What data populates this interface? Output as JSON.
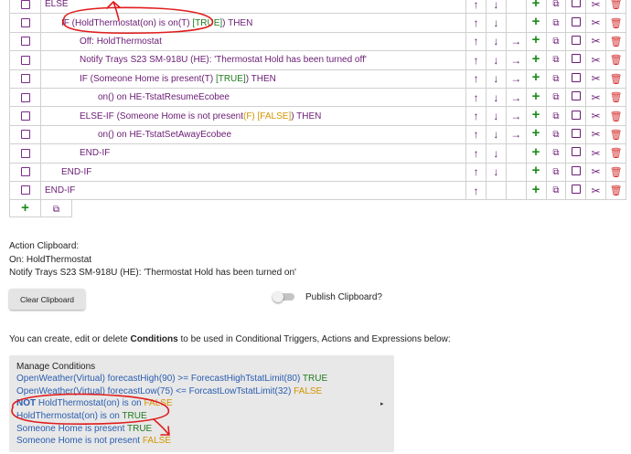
{
  "actions": {
    "rows": [
      {
        "indent": 0,
        "parts": [
          [
            "ELSE",
            "t"
          ]
        ],
        "arrows": [
          "up",
          "down"
        ]
      },
      {
        "indent": 1,
        "parts": [
          [
            "IF (HoldThermostat(on) is on(T) ",
            "t"
          ],
          [
            "[TRUE]",
            "ok"
          ],
          [
            ") THEN",
            "t"
          ]
        ],
        "arrows": [
          "up",
          "down"
        ]
      },
      {
        "indent": 2,
        "parts": [
          [
            "Off: HoldThermostat",
            "t"
          ]
        ],
        "arrows": [
          "up",
          "down",
          "right"
        ]
      },
      {
        "indent": 2,
        "parts": [
          [
            "Notify Trays S23 SM-918U (HE): 'Thermostat Hold has been turned off'",
            "t"
          ]
        ],
        "arrows": [
          "up",
          "down",
          "right"
        ]
      },
      {
        "indent": 2,
        "parts": [
          [
            "IF (Someone Home is present(T) ",
            "t"
          ],
          [
            "[TRUE]",
            "ok"
          ],
          [
            ") THEN",
            "t"
          ]
        ],
        "arrows": [
          "up",
          "down",
          "right"
        ]
      },
      {
        "indent": 3,
        "parts": [
          [
            "on() on HE-TstatResumeEcobee",
            "t"
          ]
        ],
        "arrows": [
          "up",
          "down",
          "right"
        ]
      },
      {
        "indent": 2,
        "parts": [
          [
            "ELSE-IF (Someone Home is not present",
            "t"
          ],
          [
            "(F) [FALSE]",
            "bad"
          ],
          [
            ") THEN",
            "t"
          ]
        ],
        "arrows": [
          "up",
          "down",
          "right"
        ]
      },
      {
        "indent": 3,
        "parts": [
          [
            "on() on HE-TstatSetAwayEcobee",
            "t"
          ]
        ],
        "arrows": [
          "up",
          "down",
          "right"
        ]
      },
      {
        "indent": 2,
        "parts": [
          [
            "END-IF",
            "t"
          ]
        ],
        "arrows": [
          "up",
          "down"
        ]
      },
      {
        "indent": 1,
        "parts": [
          [
            "END-IF",
            "t"
          ]
        ],
        "arrows": [
          "up",
          "down"
        ]
      },
      {
        "indent": 0,
        "parts": [
          [
            "END-IF",
            "t"
          ]
        ],
        "arrows": [
          "up"
        ]
      }
    ]
  },
  "clipboard": {
    "title": "Action Clipboard",
    "colon": ":",
    "line1": "On: HoldThermostat",
    "line2": "Notify Trays S23 SM-918U (HE): 'Thermostat Hold has been turned on'",
    "clear_label": "Clear Clipboard",
    "publish_label": "Publish Clipboard?",
    "publish_enabled": false
  },
  "conditions": {
    "intro_prefix": "You can create, edit or delete ",
    "intro_bold": "Conditions",
    "intro_suffix": " to be used in Conditional Triggers, Actions and Expressions below:",
    "title": "Manage Conditions",
    "l1a": "OpenWeather(Virtual) forecastHigh(90) >= ForecastHighTstatLimit(80) ",
    "l1b": "TRUE",
    "l2a": "OpenWeather(Virtual) forecastLow(75) <= ForcastLowTstatLimit(32) ",
    "l2b": "FALSE",
    "l3not": "NOT",
    "l3a": " HoldThermostat(on) is on ",
    "l3b": "FALSE",
    "l4a": "HoldThermostat(on) is on ",
    "l4b": "TRUE",
    "l5a": "Someone Home is present ",
    "l5b": "TRUE",
    "l6a": "Someone Home is not present ",
    "l6b": "FALSE",
    "expand_glyph": "▸"
  },
  "colors": {
    "true": "#1f7a1f",
    "false": "#d39400",
    "link": "#2a5db0",
    "accent": "#6a1b74",
    "delete": "#d32f2f",
    "annotation": "#e01c1c"
  }
}
